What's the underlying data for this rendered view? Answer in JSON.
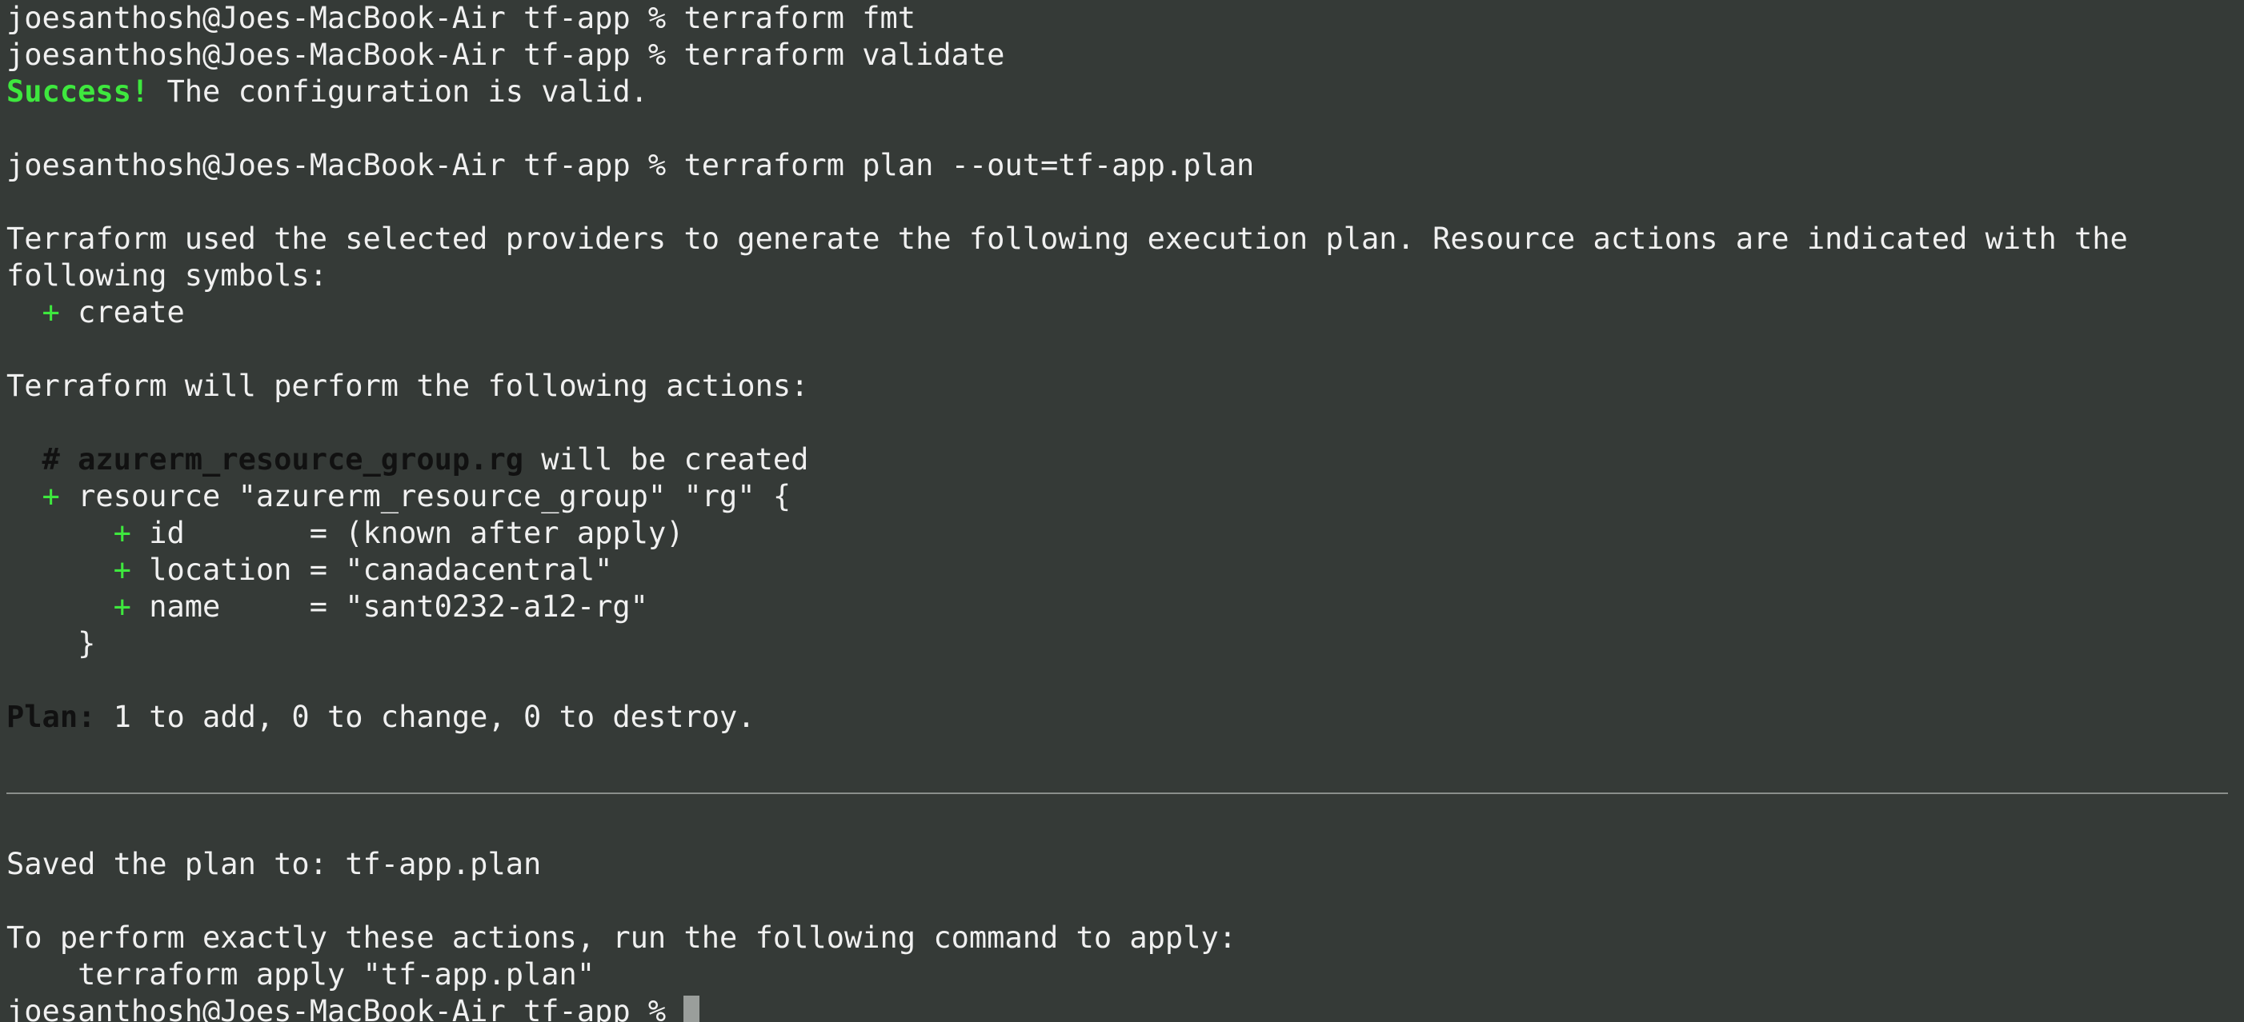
{
  "prompt": "joesanthosh@Joes-MacBook-Air tf-app % ",
  "commands": {
    "fmt": "terraform fmt",
    "validate": "terraform validate",
    "plan": "terraform plan --out=tf-app.plan"
  },
  "validate_output": {
    "success_label": "Success!",
    "message": " The configuration is valid."
  },
  "plan_intro": {
    "line1": "Terraform used the selected providers to generate the following execution plan. Resource actions are indicated with the",
    "line2": "following symbols:",
    "symbol": "  +",
    "symbol_label": " create"
  },
  "actions_header": "Terraform will perform the following actions:",
  "resource": {
    "comment_prefix": "  # ",
    "address": "azurerm_resource_group.rg",
    "comment_suffix": " will be created",
    "plus": "  +",
    "declaration": " resource \"azurerm_resource_group\" \"rg\" {",
    "attributes": [
      {
        "plus": "      +",
        "text": " id       = (known after apply)"
      },
      {
        "plus": "      +",
        "text": " location = \"canadacentral\""
      },
      {
        "plus": "      +",
        "text": " name     = \"sant0232-a12-rg\""
      }
    ],
    "closing": "    }"
  },
  "plan_summary": {
    "label": "Plan:",
    "text": " 1 to add, 0 to change, 0 to destroy."
  },
  "saved_line": "Saved the plan to: tf-app.plan",
  "apply_hint": {
    "line1": "To perform exactly these actions, run the following command to apply:",
    "command": "    terraform apply \"tf-app.plan\""
  },
  "colors": {
    "background": "#353a37",
    "foreground": "#f0f0f0",
    "success_green": "#3ee83e",
    "bold_black": "#111111"
  }
}
